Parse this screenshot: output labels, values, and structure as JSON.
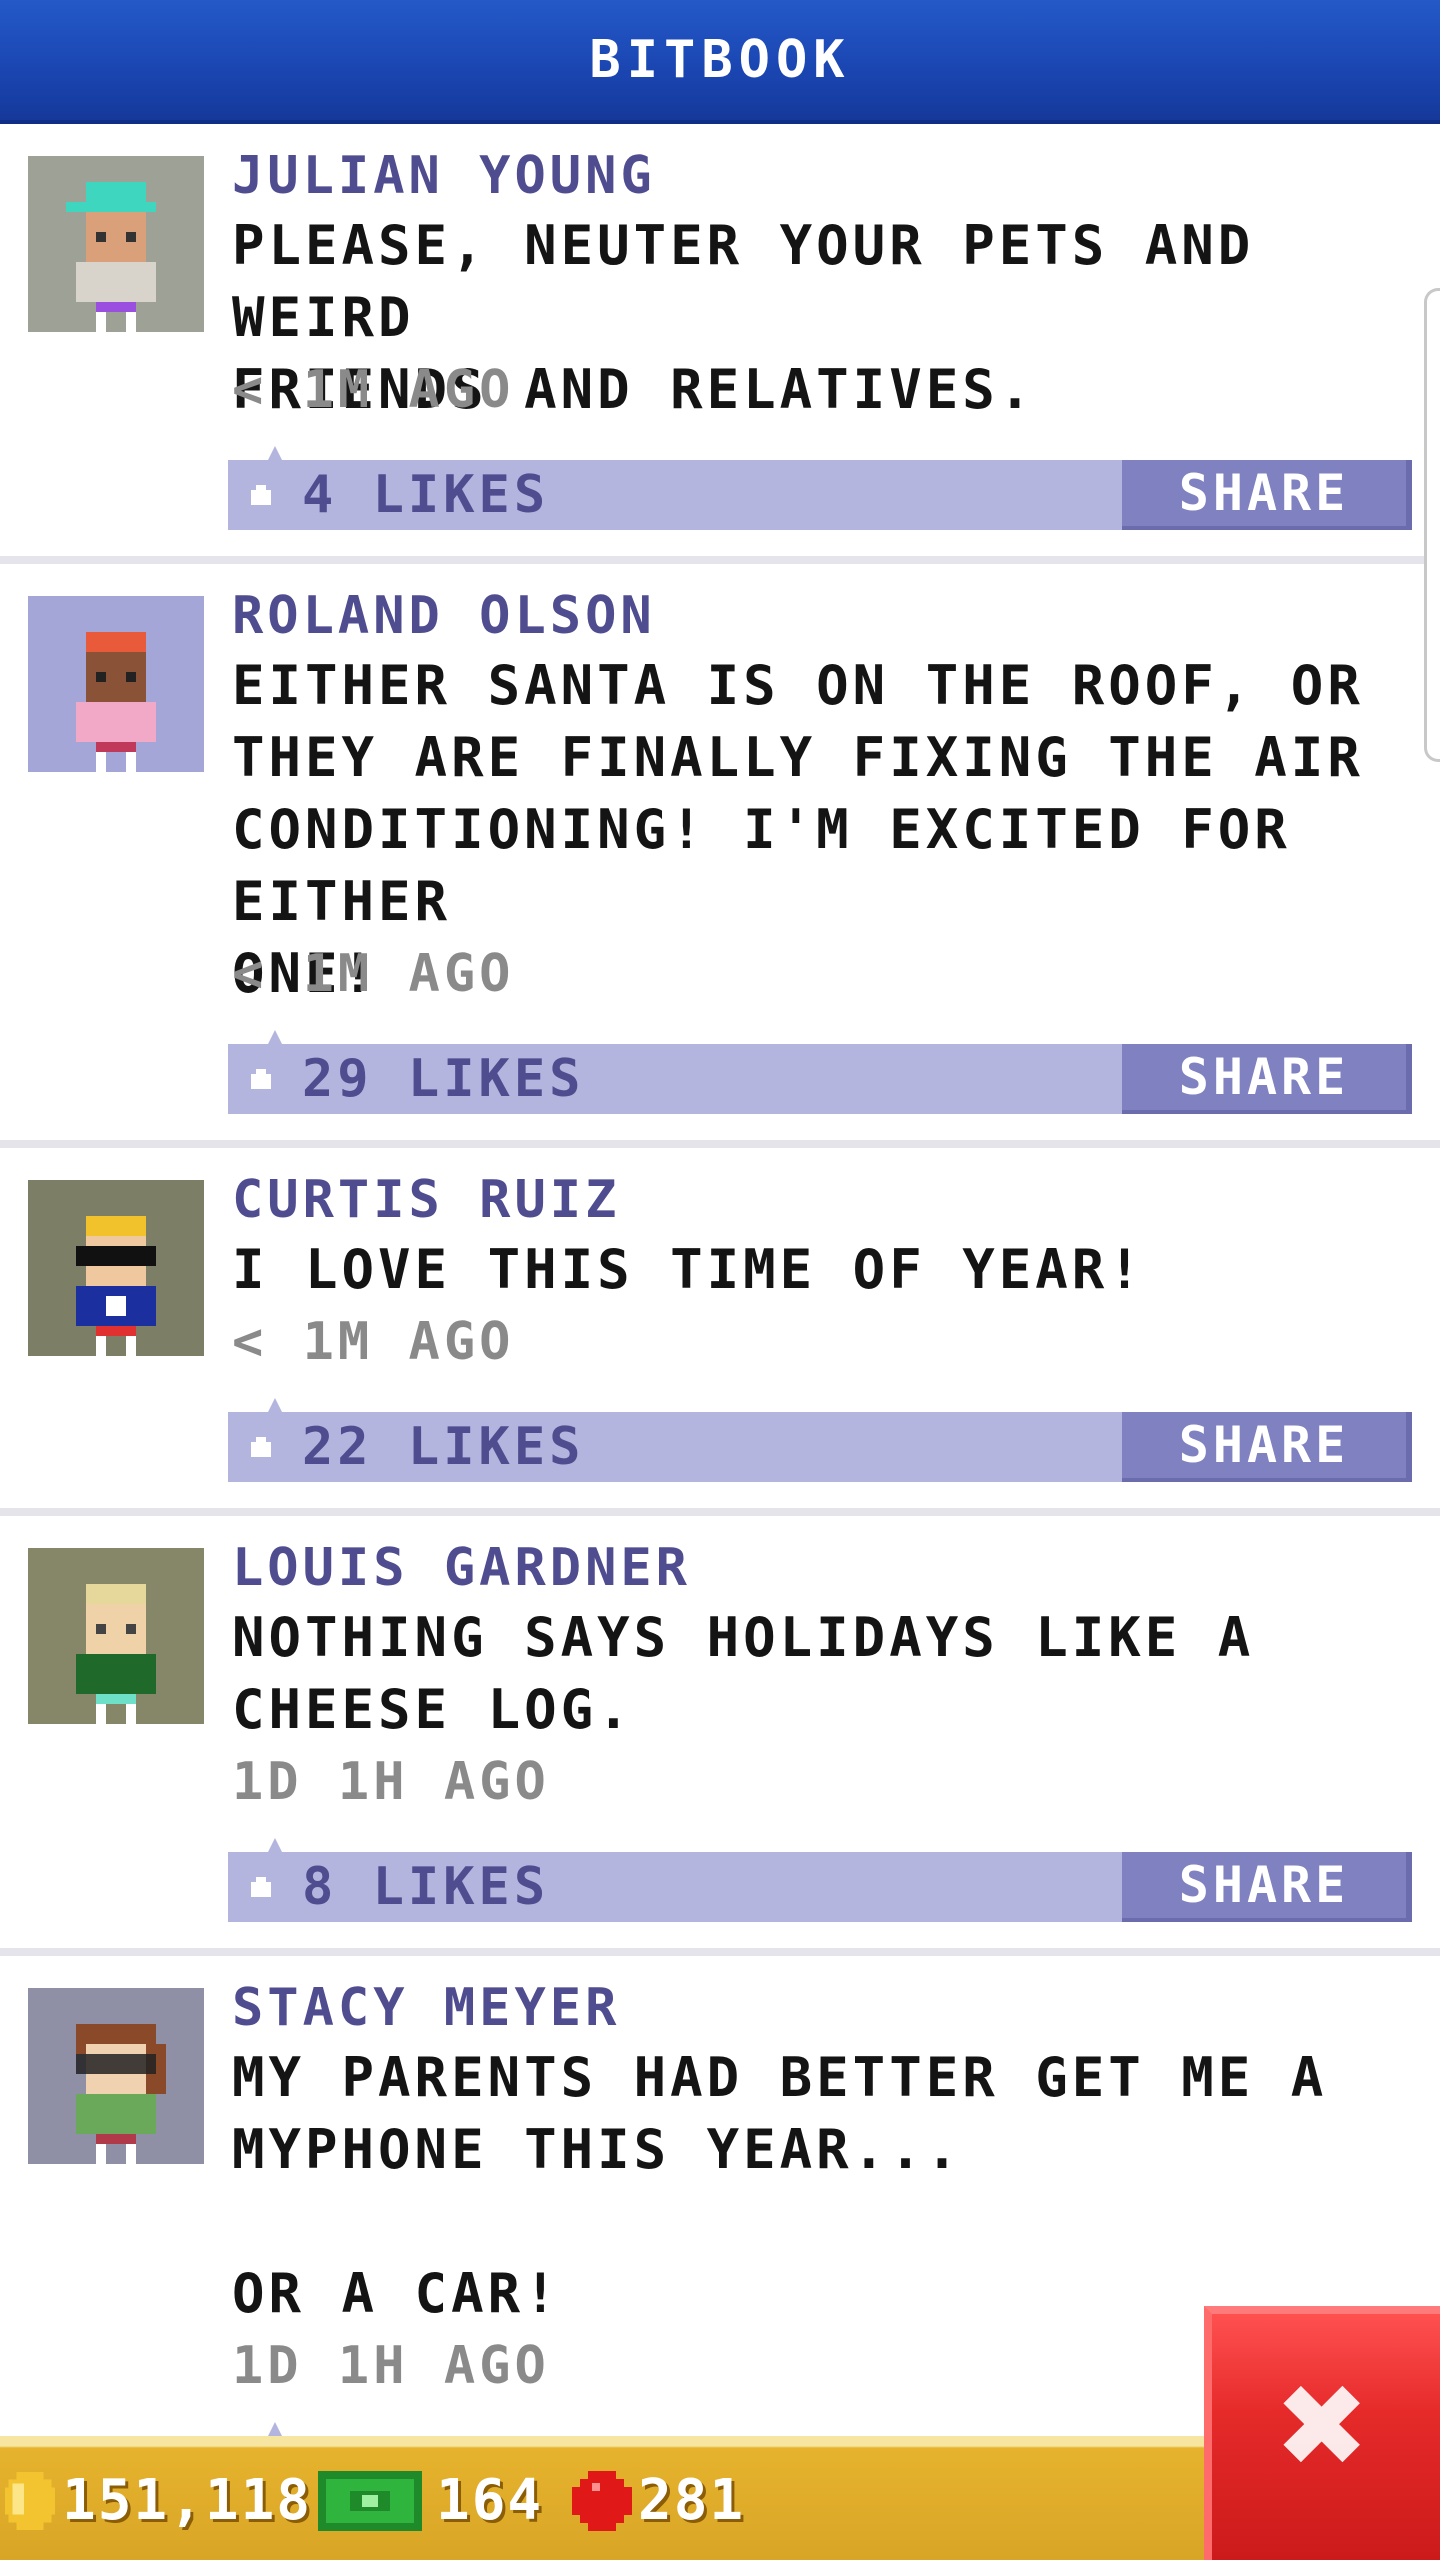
{
  "header": {
    "title": "BITBOOK"
  },
  "posts": [
    {
      "author": "JULIAN YOUNG",
      "body": "PLEASE, NEUTER YOUR PETS AND WEIRD\nFRIENDS AND RELATIVES.",
      "time": "< 1M AGO",
      "likes": "4 LIKES",
      "share": "SHARE",
      "avatar_bg": "#9ea196"
    },
    {
      "author": "ROLAND OLSON",
      "body": "EITHER SANTA IS ON THE ROOF, OR\nTHEY ARE FINALLY FIXING THE AIR\nCONDITIONING! I'M EXCITED FOR EITHER\nONE!",
      "time": "< 1M AGO",
      "likes": "29 LIKES",
      "share": "SHARE",
      "avatar_bg": "#a4a6d8"
    },
    {
      "author": "CURTIS RUIZ",
      "body": "I LOVE THIS TIME OF YEAR!",
      "time": "< 1M AGO",
      "likes": "22 LIKES",
      "share": "SHARE",
      "avatar_bg": "#7d7e66"
    },
    {
      "author": "LOUIS GARDNER",
      "body": "NOTHING SAYS HOLIDAYS LIKE A\nCHEESE LOG.",
      "time": "1D 1H AGO",
      "likes": "8 LIKES",
      "share": "SHARE",
      "avatar_bg": "#858768"
    },
    {
      "author": "STACY MEYER",
      "body": "MY PARENTS HAD BETTER GET ME A\nMYPHONE THIS YEAR...\n\nOR A CAR!",
      "time": "1D 1H AGO",
      "avatar_bg": "#8f90a6"
    }
  ],
  "currency": {
    "coins": "151,118",
    "bux": "164",
    "tickets": "281"
  },
  "colors": {
    "header": "#1a45b1",
    "author": "#4f4d8f",
    "like_bar": "#b3b5de",
    "share_button": "#7f81c0",
    "bottom_bar": "#e6b32e",
    "close_button": "#e62a2a"
  }
}
